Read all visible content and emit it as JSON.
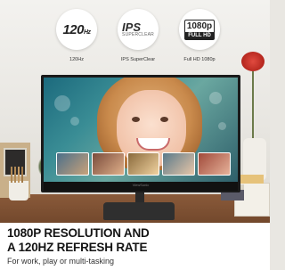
{
  "badges": [
    {
      "icon": "refresh-rate-icon",
      "value": "120",
      "unit": "Hz",
      "label": "120Hz"
    },
    {
      "icon": "ips-panel-icon",
      "value": "IPS",
      "sub": "SUPERCLEAR",
      "label": "IPS SuperClear"
    },
    {
      "icon": "full-hd-icon",
      "value": "1080p",
      "sub": "FULL HD",
      "label": "Full HD 1080p"
    }
  ],
  "monitor": {
    "logo": "ViewSonic"
  },
  "headline": {
    "line1": "1080P RESOLUTION AND",
    "line2": "A 120HZ REFRESH RATE",
    "sub": "For work, play or multi-tasking"
  }
}
